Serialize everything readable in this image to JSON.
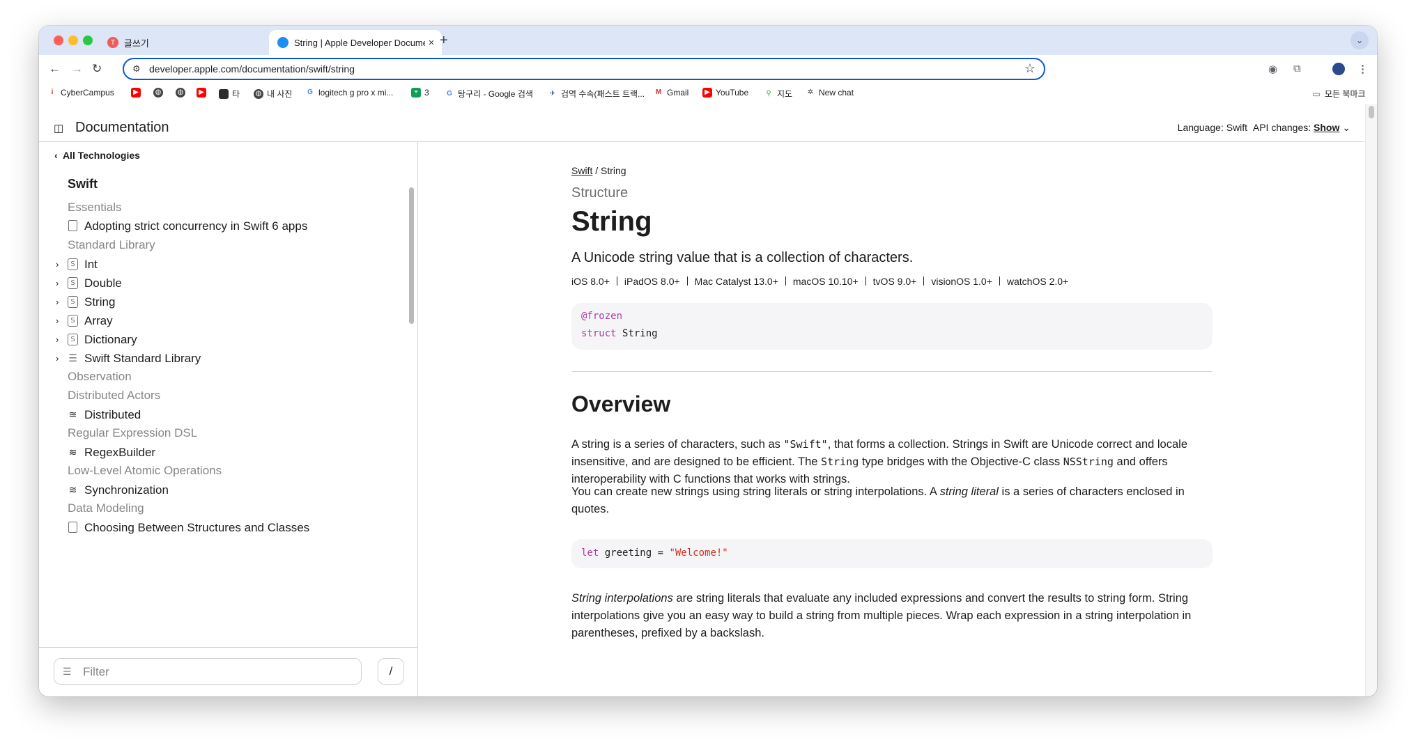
{
  "browser": {
    "tabs": [
      {
        "title": "글쓰기",
        "active": false
      },
      {
        "title": "String | Apple Developer Documentation",
        "active": true
      }
    ],
    "url": "developer.apple.com/documentation/swift/string",
    "bookmarks": [
      {
        "label": "CyberCampus",
        "icon": "cybercampus-icon"
      },
      {
        "label": "",
        "icon": "youtube-icon"
      },
      {
        "label": "",
        "icon": "globe-icon"
      },
      {
        "label": "",
        "icon": "globe-icon"
      },
      {
        "label": "",
        "icon": "youtube-icon"
      },
      {
        "label": "타",
        "icon": "app-icon"
      },
      {
        "label": "내 사진",
        "icon": "globe-icon"
      },
      {
        "label": "logitech g pro x mi...",
        "icon": "google-icon"
      },
      {
        "label": "3",
        "icon": "sheets-icon"
      },
      {
        "label": "탕구리 - Google 검색",
        "icon": "google-icon"
      },
      {
        "label": "검역 수속(패스트 트랙...",
        "icon": "plane-icon"
      },
      {
        "label": "Gmail",
        "icon": "gmail-icon"
      },
      {
        "label": "YouTube",
        "icon": "youtube-icon"
      },
      {
        "label": "지도",
        "icon": "maps-icon"
      },
      {
        "label": "New chat",
        "icon": "chatgpt-icon"
      }
    ],
    "all_bookmarks": "모든 북마크"
  },
  "docbar": {
    "title": "Documentation",
    "language_label": "Language:",
    "language_value": "Swift",
    "api_changes_label": "API changes:",
    "api_changes_value": "Show"
  },
  "sidebar": {
    "back": "All Technologies",
    "title": "Swift",
    "items": [
      {
        "kind": "group",
        "label": "Essentials"
      },
      {
        "kind": "article",
        "label": "Adopting strict concurrency in Swift 6 apps"
      },
      {
        "kind": "group",
        "label": "Standard Library"
      },
      {
        "kind": "struct",
        "label": "Int",
        "expandable": true
      },
      {
        "kind": "struct",
        "label": "Double",
        "expandable": true
      },
      {
        "kind": "struct",
        "label": "String",
        "expandable": true
      },
      {
        "kind": "struct",
        "label": "Array",
        "expandable": true
      },
      {
        "kind": "struct",
        "label": "Dictionary",
        "expandable": true
      },
      {
        "kind": "collection",
        "label": "Swift Standard Library",
        "expandable": true
      },
      {
        "kind": "group",
        "label": "Observation"
      },
      {
        "kind": "group",
        "label": "Distributed Actors"
      },
      {
        "kind": "framework",
        "label": "Distributed"
      },
      {
        "kind": "group",
        "label": "Regular Expression DSL"
      },
      {
        "kind": "framework",
        "label": "RegexBuilder"
      },
      {
        "kind": "group",
        "label": "Low-Level Atomic Operations"
      },
      {
        "kind": "framework",
        "label": "Synchronization"
      },
      {
        "kind": "group",
        "label": "Data Modeling"
      },
      {
        "kind": "article",
        "label": "Choosing Between Structures and Classes"
      }
    ],
    "filter_placeholder": "Filter",
    "filter_shortcut": "/"
  },
  "content": {
    "breadcrumb": [
      "Swift",
      "String"
    ],
    "kind": "Structure",
    "title": "String",
    "abstract": "A Unicode string value that is a collection of characters.",
    "platforms": [
      "iOS 8.0+",
      "iPadOS 8.0+",
      "Mac Catalyst 13.0+",
      "macOS 10.10+",
      "tvOS 9.0+",
      "visionOS 1.0+",
      "watchOS 2.0+"
    ],
    "declaration": {
      "attribute": "@frozen",
      "keyword": "struct",
      "name": "String"
    },
    "overview_heading": "Overview",
    "p1": {
      "t1": "A string is a series of characters, such as ",
      "c1": "\"Swift\"",
      "t2": ", that forms a collection. Strings in Swift are Unicode correct and locale insensitive, and are designed to be efficient. The ",
      "c2": "String",
      "t3": " type bridges with the Objective-C class ",
      "c3": "NSString",
      "t4": " and offers interoperability with C functions that works with strings."
    },
    "p2": {
      "t1": "You can create new strings using string literals or string interpolations. A ",
      "em": "string literal",
      "t2": " is a series of characters enclosed in quotes."
    },
    "code": {
      "keyword": "let",
      "rest": " greeting = ",
      "string": "\"Welcome!\""
    },
    "p3": {
      "em": "String interpolations",
      "t1": " are string literals that evaluate any included expressions and convert the results to string form. String interpolations give you an easy way to build a string from multiple pieces. Wrap each expression in a string interpolation in parentheses, prefixed by a backslash."
    }
  },
  "colors": {
    "accent": "#0b57d0",
    "tabstrip": "#dce6f6",
    "swift_keyword": "#ad3da4",
    "swift_string": "#d12f1b"
  }
}
